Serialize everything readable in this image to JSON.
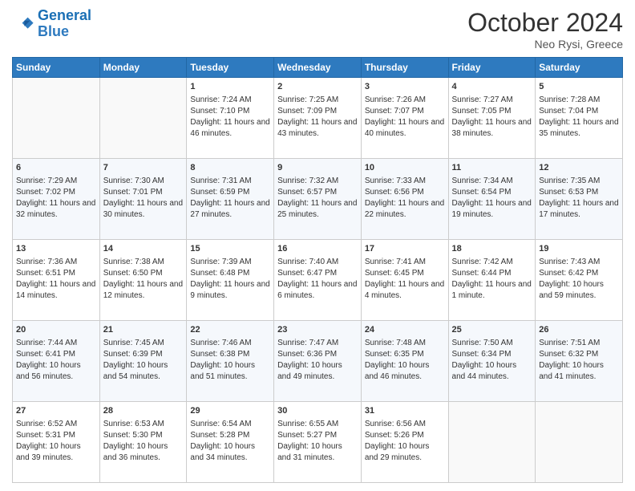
{
  "header": {
    "logo_line1": "General",
    "logo_line2": "Blue",
    "month": "October 2024",
    "location": "Neo Rysi, Greece"
  },
  "weekdays": [
    "Sunday",
    "Monday",
    "Tuesday",
    "Wednesday",
    "Thursday",
    "Friday",
    "Saturday"
  ],
  "weeks": [
    [
      {
        "day": "",
        "sunrise": "",
        "sunset": "",
        "daylight": ""
      },
      {
        "day": "",
        "sunrise": "",
        "sunset": "",
        "daylight": ""
      },
      {
        "day": "1",
        "sunrise": "Sunrise: 7:24 AM",
        "sunset": "Sunset: 7:10 PM",
        "daylight": "Daylight: 11 hours and 46 minutes."
      },
      {
        "day": "2",
        "sunrise": "Sunrise: 7:25 AM",
        "sunset": "Sunset: 7:09 PM",
        "daylight": "Daylight: 11 hours and 43 minutes."
      },
      {
        "day": "3",
        "sunrise": "Sunrise: 7:26 AM",
        "sunset": "Sunset: 7:07 PM",
        "daylight": "Daylight: 11 hours and 40 minutes."
      },
      {
        "day": "4",
        "sunrise": "Sunrise: 7:27 AM",
        "sunset": "Sunset: 7:05 PM",
        "daylight": "Daylight: 11 hours and 38 minutes."
      },
      {
        "day": "5",
        "sunrise": "Sunrise: 7:28 AM",
        "sunset": "Sunset: 7:04 PM",
        "daylight": "Daylight: 11 hours and 35 minutes."
      }
    ],
    [
      {
        "day": "6",
        "sunrise": "Sunrise: 7:29 AM",
        "sunset": "Sunset: 7:02 PM",
        "daylight": "Daylight: 11 hours and 32 minutes."
      },
      {
        "day": "7",
        "sunrise": "Sunrise: 7:30 AM",
        "sunset": "Sunset: 7:01 PM",
        "daylight": "Daylight: 11 hours and 30 minutes."
      },
      {
        "day": "8",
        "sunrise": "Sunrise: 7:31 AM",
        "sunset": "Sunset: 6:59 PM",
        "daylight": "Daylight: 11 hours and 27 minutes."
      },
      {
        "day": "9",
        "sunrise": "Sunrise: 7:32 AM",
        "sunset": "Sunset: 6:57 PM",
        "daylight": "Daylight: 11 hours and 25 minutes."
      },
      {
        "day": "10",
        "sunrise": "Sunrise: 7:33 AM",
        "sunset": "Sunset: 6:56 PM",
        "daylight": "Daylight: 11 hours and 22 minutes."
      },
      {
        "day": "11",
        "sunrise": "Sunrise: 7:34 AM",
        "sunset": "Sunset: 6:54 PM",
        "daylight": "Daylight: 11 hours and 19 minutes."
      },
      {
        "day": "12",
        "sunrise": "Sunrise: 7:35 AM",
        "sunset": "Sunset: 6:53 PM",
        "daylight": "Daylight: 11 hours and 17 minutes."
      }
    ],
    [
      {
        "day": "13",
        "sunrise": "Sunrise: 7:36 AM",
        "sunset": "Sunset: 6:51 PM",
        "daylight": "Daylight: 11 hours and 14 minutes."
      },
      {
        "day": "14",
        "sunrise": "Sunrise: 7:38 AM",
        "sunset": "Sunset: 6:50 PM",
        "daylight": "Daylight: 11 hours and 12 minutes."
      },
      {
        "day": "15",
        "sunrise": "Sunrise: 7:39 AM",
        "sunset": "Sunset: 6:48 PM",
        "daylight": "Daylight: 11 hours and 9 minutes."
      },
      {
        "day": "16",
        "sunrise": "Sunrise: 7:40 AM",
        "sunset": "Sunset: 6:47 PM",
        "daylight": "Daylight: 11 hours and 6 minutes."
      },
      {
        "day": "17",
        "sunrise": "Sunrise: 7:41 AM",
        "sunset": "Sunset: 6:45 PM",
        "daylight": "Daylight: 11 hours and 4 minutes."
      },
      {
        "day": "18",
        "sunrise": "Sunrise: 7:42 AM",
        "sunset": "Sunset: 6:44 PM",
        "daylight": "Daylight: 11 hours and 1 minute."
      },
      {
        "day": "19",
        "sunrise": "Sunrise: 7:43 AM",
        "sunset": "Sunset: 6:42 PM",
        "daylight": "Daylight: 10 hours and 59 minutes."
      }
    ],
    [
      {
        "day": "20",
        "sunrise": "Sunrise: 7:44 AM",
        "sunset": "Sunset: 6:41 PM",
        "daylight": "Daylight: 10 hours and 56 minutes."
      },
      {
        "day": "21",
        "sunrise": "Sunrise: 7:45 AM",
        "sunset": "Sunset: 6:39 PM",
        "daylight": "Daylight: 10 hours and 54 minutes."
      },
      {
        "day": "22",
        "sunrise": "Sunrise: 7:46 AM",
        "sunset": "Sunset: 6:38 PM",
        "daylight": "Daylight: 10 hours and 51 minutes."
      },
      {
        "day": "23",
        "sunrise": "Sunrise: 7:47 AM",
        "sunset": "Sunset: 6:36 PM",
        "daylight": "Daylight: 10 hours and 49 minutes."
      },
      {
        "day": "24",
        "sunrise": "Sunrise: 7:48 AM",
        "sunset": "Sunset: 6:35 PM",
        "daylight": "Daylight: 10 hours and 46 minutes."
      },
      {
        "day": "25",
        "sunrise": "Sunrise: 7:50 AM",
        "sunset": "Sunset: 6:34 PM",
        "daylight": "Daylight: 10 hours and 44 minutes."
      },
      {
        "day": "26",
        "sunrise": "Sunrise: 7:51 AM",
        "sunset": "Sunset: 6:32 PM",
        "daylight": "Daylight: 10 hours and 41 minutes."
      }
    ],
    [
      {
        "day": "27",
        "sunrise": "Sunrise: 6:52 AM",
        "sunset": "Sunset: 5:31 PM",
        "daylight": "Daylight: 10 hours and 39 minutes."
      },
      {
        "day": "28",
        "sunrise": "Sunrise: 6:53 AM",
        "sunset": "Sunset: 5:30 PM",
        "daylight": "Daylight: 10 hours and 36 minutes."
      },
      {
        "day": "29",
        "sunrise": "Sunrise: 6:54 AM",
        "sunset": "Sunset: 5:28 PM",
        "daylight": "Daylight: 10 hours and 34 minutes."
      },
      {
        "day": "30",
        "sunrise": "Sunrise: 6:55 AM",
        "sunset": "Sunset: 5:27 PM",
        "daylight": "Daylight: 10 hours and 31 minutes."
      },
      {
        "day": "31",
        "sunrise": "Sunrise: 6:56 AM",
        "sunset": "Sunset: 5:26 PM",
        "daylight": "Daylight: 10 hours and 29 minutes."
      },
      {
        "day": "",
        "sunrise": "",
        "sunset": "",
        "daylight": ""
      },
      {
        "day": "",
        "sunrise": "",
        "sunset": "",
        "daylight": ""
      }
    ]
  ]
}
